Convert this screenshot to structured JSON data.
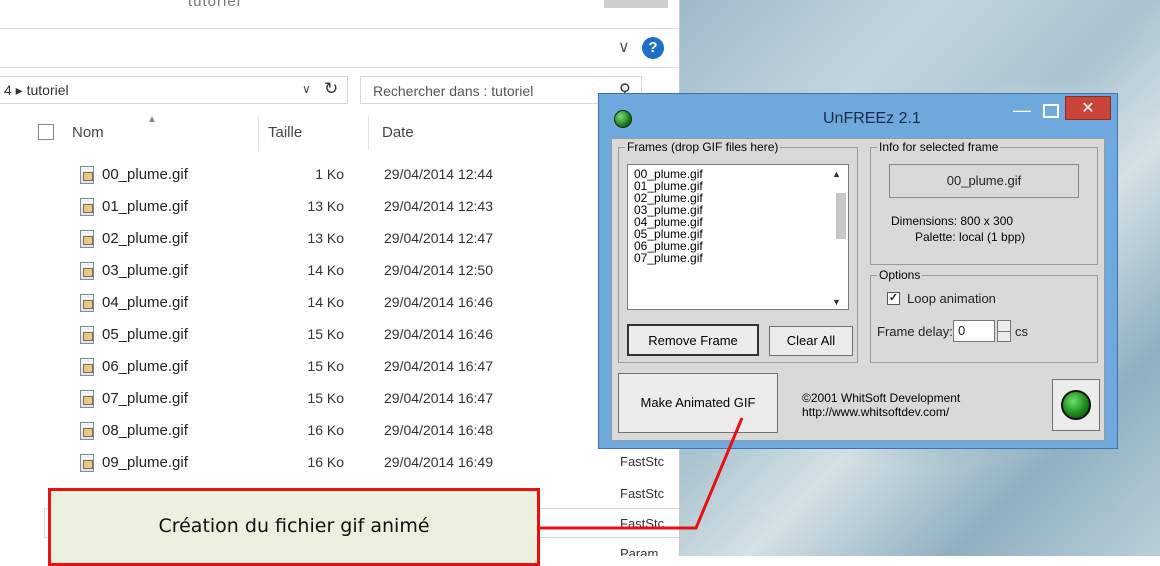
{
  "explorer": {
    "title": "tutoriel",
    "address": "4 ▸ tutoriel",
    "search_placeholder": "Rechercher dans : tutoriel",
    "columns": {
      "name": "Nom",
      "size": "Taille",
      "date": "Date"
    },
    "files": [
      {
        "name": "00_plume.gif",
        "size": "1 Ko",
        "date": "29/04/2014 12:44"
      },
      {
        "name": "01_plume.gif",
        "size": "13 Ko",
        "date": "29/04/2014 12:43"
      },
      {
        "name": "02_plume.gif",
        "size": "13 Ko",
        "date": "29/04/2014 12:47"
      },
      {
        "name": "03_plume.gif",
        "size": "14 Ko",
        "date": "29/04/2014 12:50"
      },
      {
        "name": "04_plume.gif",
        "size": "14 Ko",
        "date": "29/04/2014 16:46"
      },
      {
        "name": "05_plume.gif",
        "size": "15 Ko",
        "date": "29/04/2014 16:46"
      },
      {
        "name": "06_plume.gif",
        "size": "15 Ko",
        "date": "29/04/2014 16:47"
      },
      {
        "name": "07_plume.gif",
        "size": "15 Ko",
        "date": "29/04/2014 16:47"
      },
      {
        "name": "08_plume.gif",
        "size": "16 Ko",
        "date": "29/04/2014 16:48"
      },
      {
        "name": "09_plume.gif",
        "size": "16 Ko",
        "date": "29/04/2014 16:49",
        "type": "FastStc"
      }
    ],
    "extra_types": [
      "FastStc",
      "FastStc",
      "Param"
    ]
  },
  "unfreez": {
    "title": "UnFREEz 2.1",
    "close_glyph": "✕",
    "frames_group_label": "Frames (drop GIF files here)",
    "frames": [
      "00_plume.gif",
      "01_plume.gif",
      "02_plume.gif",
      "03_plume.gif",
      "04_plume.gif",
      "05_plume.gif",
      "06_plume.gif",
      "07_plume.gif"
    ],
    "remove_frame": "Remove Frame",
    "clear_all": "Clear All",
    "info_group_label": "Info for selected frame",
    "selected_frame": "00_plume.gif",
    "dimensions": "Dimensions: 800 x 300",
    "palette": "Palette: local (1 bpp)",
    "options_group_label": "Options",
    "loop_checked_glyph": "✓",
    "loop_label": "Loop animation",
    "frame_delay_label": "Frame delay:",
    "frame_delay_value": "0",
    "frame_delay_unit": "cs",
    "make_gif": "Make Animated GIF",
    "copyright_line1": "©2001 WhitSoft Development",
    "copyright_line2": "http://www.whitsoftdev.com/"
  },
  "annotation": {
    "text": "Création du fichier gif animé",
    "color": "#e81010"
  }
}
